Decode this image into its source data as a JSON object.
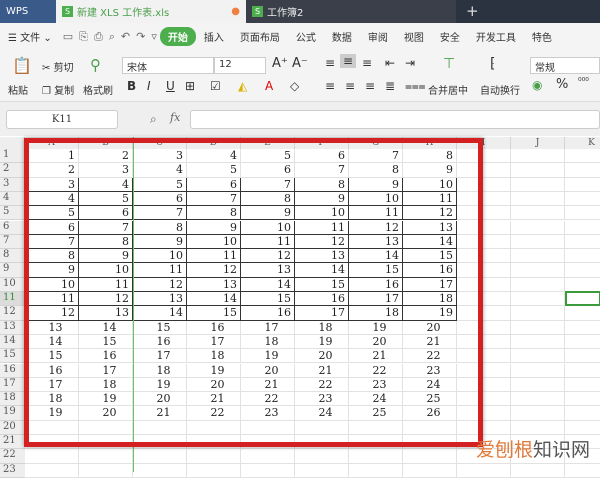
{
  "tabs": [
    {
      "label": "WPS"
    },
    {
      "label": "新建 XLS 工作表.xls"
    },
    {
      "label": "工作簿2"
    }
  ],
  "menu": {
    "file": "文件",
    "items": [
      "开始",
      "插入",
      "页面布局",
      "公式",
      "数据",
      "审阅",
      "视图",
      "安全",
      "开发工具",
      "特色"
    ]
  },
  "toolbar": {
    "paste": "粘贴",
    "cut": "剪切",
    "copy": "复制",
    "format_painter": "格式刷",
    "font": "宋体",
    "size": "12",
    "merge": "合并居中",
    "wrap": "自动换行",
    "number_format": "常规",
    "percent": "%"
  },
  "formula": {
    "name_box": "K11",
    "fx": "fx",
    "value": ""
  },
  "accent": "#4cae4c",
  "highlight": "#d42020",
  "columns": [
    "A",
    "B",
    "C",
    "D",
    "E",
    "F",
    "G",
    "H",
    "I",
    "J",
    "K"
  ],
  "row_numbers": [
    "1",
    "2",
    "3",
    "4",
    "5",
    "6",
    "7",
    "8",
    "9",
    "10",
    "11",
    "12",
    "13",
    "14",
    "15",
    "16",
    "17",
    "18",
    "19",
    "20",
    "21",
    "22",
    "23"
  ],
  "rows": [
    [
      1,
      2,
      3,
      4,
      5,
      6,
      7,
      8
    ],
    [
      2,
      3,
      4,
      5,
      6,
      7,
      8,
      9
    ],
    [
      3,
      4,
      5,
      6,
      7,
      8,
      9,
      10
    ],
    [
      4,
      5,
      6,
      7,
      8,
      9,
      10,
      11
    ],
    [
      5,
      6,
      7,
      8,
      9,
      10,
      11,
      12
    ],
    [
      6,
      7,
      8,
      9,
      10,
      11,
      12,
      13
    ],
    [
      7,
      8,
      9,
      10,
      11,
      12,
      13,
      14
    ],
    [
      8,
      9,
      10,
      11,
      12,
      13,
      14,
      15
    ],
    [
      9,
      10,
      11,
      12,
      13,
      14,
      15,
      16
    ],
    [
      10,
      11,
      12,
      13,
      14,
      15,
      16,
      17
    ],
    [
      11,
      12,
      13,
      14,
      15,
      16,
      17,
      18
    ],
    [
      12,
      13,
      14,
      15,
      16,
      17,
      18,
      19
    ],
    [
      13,
      14,
      15,
      16,
      17,
      18,
      19,
      20
    ],
    [
      14,
      15,
      16,
      17,
      18,
      19,
      20,
      21
    ],
    [
      15,
      16,
      17,
      18,
      19,
      20,
      21,
      22
    ],
    [
      16,
      17,
      18,
      19,
      20,
      21,
      22,
      23
    ],
    [
      17,
      18,
      19,
      20,
      21,
      22,
      23,
      24
    ],
    [
      18,
      19,
      20,
      21,
      22,
      23,
      24,
      25
    ],
    [
      19,
      20,
      21,
      22,
      23,
      24,
      25,
      26
    ]
  ],
  "selected_cell": "K11",
  "watermark": {
    "a": "爱刨根",
    "b": "知识网"
  }
}
